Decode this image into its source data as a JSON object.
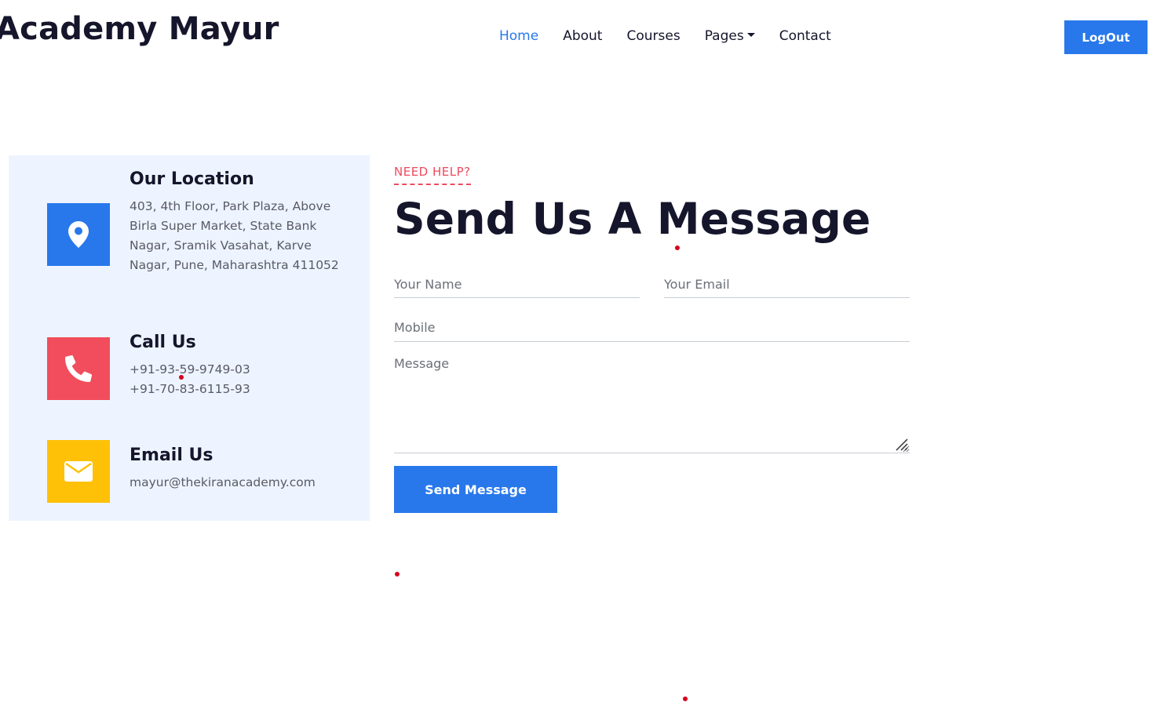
{
  "header": {
    "brand": "Academy Mayur",
    "nav": [
      {
        "label": "Home",
        "active": true
      },
      {
        "label": "About"
      },
      {
        "label": "Courses"
      },
      {
        "label": "Pages",
        "has_dropdown": true
      },
      {
        "label": "Contact"
      }
    ],
    "logout_label": "LogOut"
  },
  "contact_info": {
    "location": {
      "title": "Our Location",
      "text": "403, 4th Floor, Park Plaza, Above Birla Super Market, State Bank Nagar, Sramik Vasahat, Karve Nagar, Pune, Maharashtra 411052",
      "icon": "map-pin-icon",
      "color": "#2878eb"
    },
    "call": {
      "title": "Call Us",
      "phones": [
        "+91-93-59-9749-03",
        "+91-70-83-6115-93"
      ],
      "icon": "phone-icon",
      "color": "#f14d5d"
    },
    "email": {
      "title": "Email Us",
      "text": "mayur@thekiranacademy.com",
      "icon": "envelope-icon",
      "color": "#fec107"
    }
  },
  "form": {
    "eyebrow": "NEED HELP?",
    "heading": "Send Us A Message",
    "name_placeholder": "Your Name",
    "email_placeholder": "Your Email",
    "mobile_placeholder": "Mobile",
    "message_placeholder": "Message",
    "submit_label": "Send Message"
  },
  "colors": {
    "accent": "#2878eb",
    "danger": "#ee4a5e",
    "panel_bg": "#edf4ff"
  }
}
